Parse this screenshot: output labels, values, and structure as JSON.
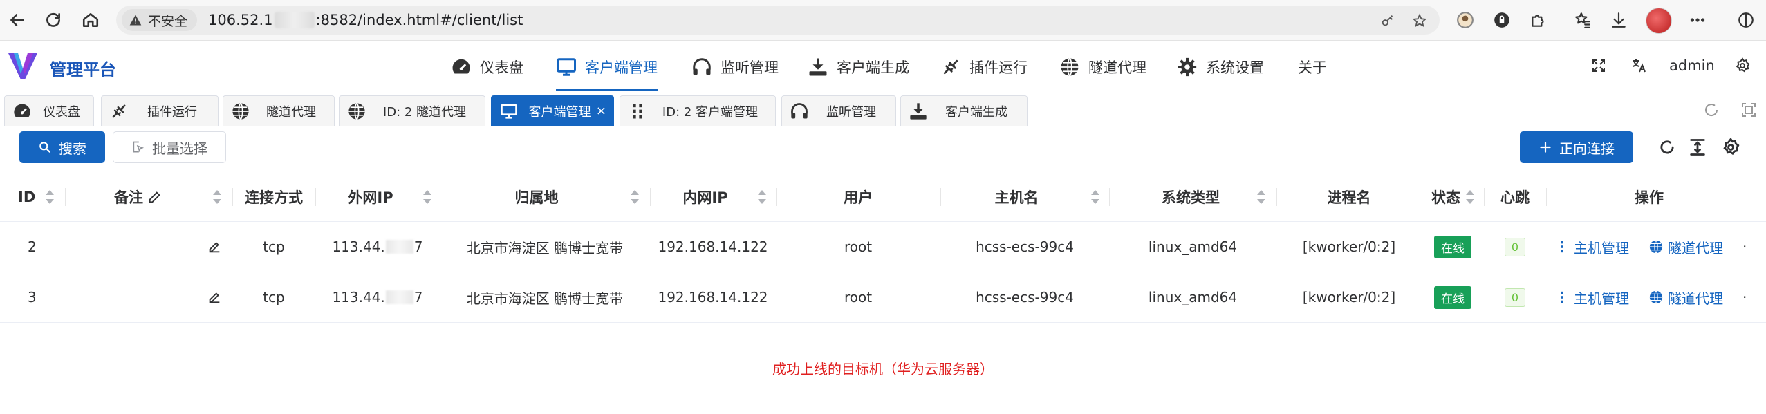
{
  "browser": {
    "security_label": "不安全",
    "url_prefix": "106.52.1",
    "url_suffix": ":8582/index.html#/client/list"
  },
  "app": {
    "brand": "管理平台",
    "menu": [
      {
        "label": "仪表盘",
        "icon": "dashboard-icon"
      },
      {
        "label": "客户端管理",
        "icon": "monitor-icon",
        "active": true
      },
      {
        "label": "监听管理",
        "icon": "headphones-icon"
      },
      {
        "label": "客户端生成",
        "icon": "download-icon"
      },
      {
        "label": "插件运行",
        "icon": "plug-icon"
      },
      {
        "label": "隧道代理",
        "icon": "globe-icon"
      },
      {
        "label": "系统设置",
        "icon": "gear-icon"
      },
      {
        "label": "关于",
        "icon": ""
      }
    ],
    "user": "admin"
  },
  "tabs": [
    {
      "label": "仪表盘",
      "icon": "dashboard-icon"
    },
    {
      "label": "插件运行",
      "icon": "plug-icon"
    },
    {
      "label": "隧道代理",
      "icon": "globe-icon"
    },
    {
      "label": "ID: 2 隧道代理",
      "icon": "globe-icon"
    },
    {
      "label": "客户端管理",
      "icon": "monitor-icon",
      "active": true,
      "close": "×"
    },
    {
      "label": "ID: 2 客户端管理",
      "icon": "grip-icon"
    },
    {
      "label": "监听管理",
      "icon": "headphones-icon"
    },
    {
      "label": "客户端生成",
      "icon": "download-icon"
    }
  ],
  "toolbar": {
    "search_label": "搜索",
    "batch_label": "批量选择",
    "connect_label": "正向连接"
  },
  "table": {
    "columns": [
      "ID",
      "备注",
      "连接方式",
      "外网IP",
      "归属地",
      "内网IP",
      "用户",
      "主机名",
      "系统类型",
      "进程名",
      "状态",
      "心跳",
      "操作"
    ],
    "rows": [
      {
        "id": "2",
        "conn": "tcp",
        "ip_prefix": "113.44.",
        "ip_suffix": "7",
        "location": "北京市海淀区 鹏博士宽带",
        "lan_ip": "192.168.14.122",
        "user": "root",
        "host": "hcss-ecs-99c4",
        "os": "linux_amd64",
        "process": "[kworker/0:2]",
        "status": "在线",
        "heartbeat": "0",
        "op_manage": "主机管理",
        "op_tunnel": "隧道代理",
        "op_more": "·"
      },
      {
        "id": "3",
        "conn": "tcp",
        "ip_prefix": "113.44.",
        "ip_suffix": "7",
        "location": "北京市海淀区 鹏博士宽带",
        "lan_ip": "192.168.14.122",
        "user": "root",
        "host": "hcss-ecs-99c4",
        "os": "linux_amd64",
        "process": "[kworker/0:2]",
        "status": "在线",
        "heartbeat": "0",
        "op_manage": "主机管理",
        "op_tunnel": "隧道代理",
        "op_more": "·"
      }
    ]
  },
  "annotation": "成功上线的目标机（华为云服务器）",
  "colors": {
    "primary": "#1565c0",
    "online": "#18a058",
    "annotation": "#e02020"
  }
}
